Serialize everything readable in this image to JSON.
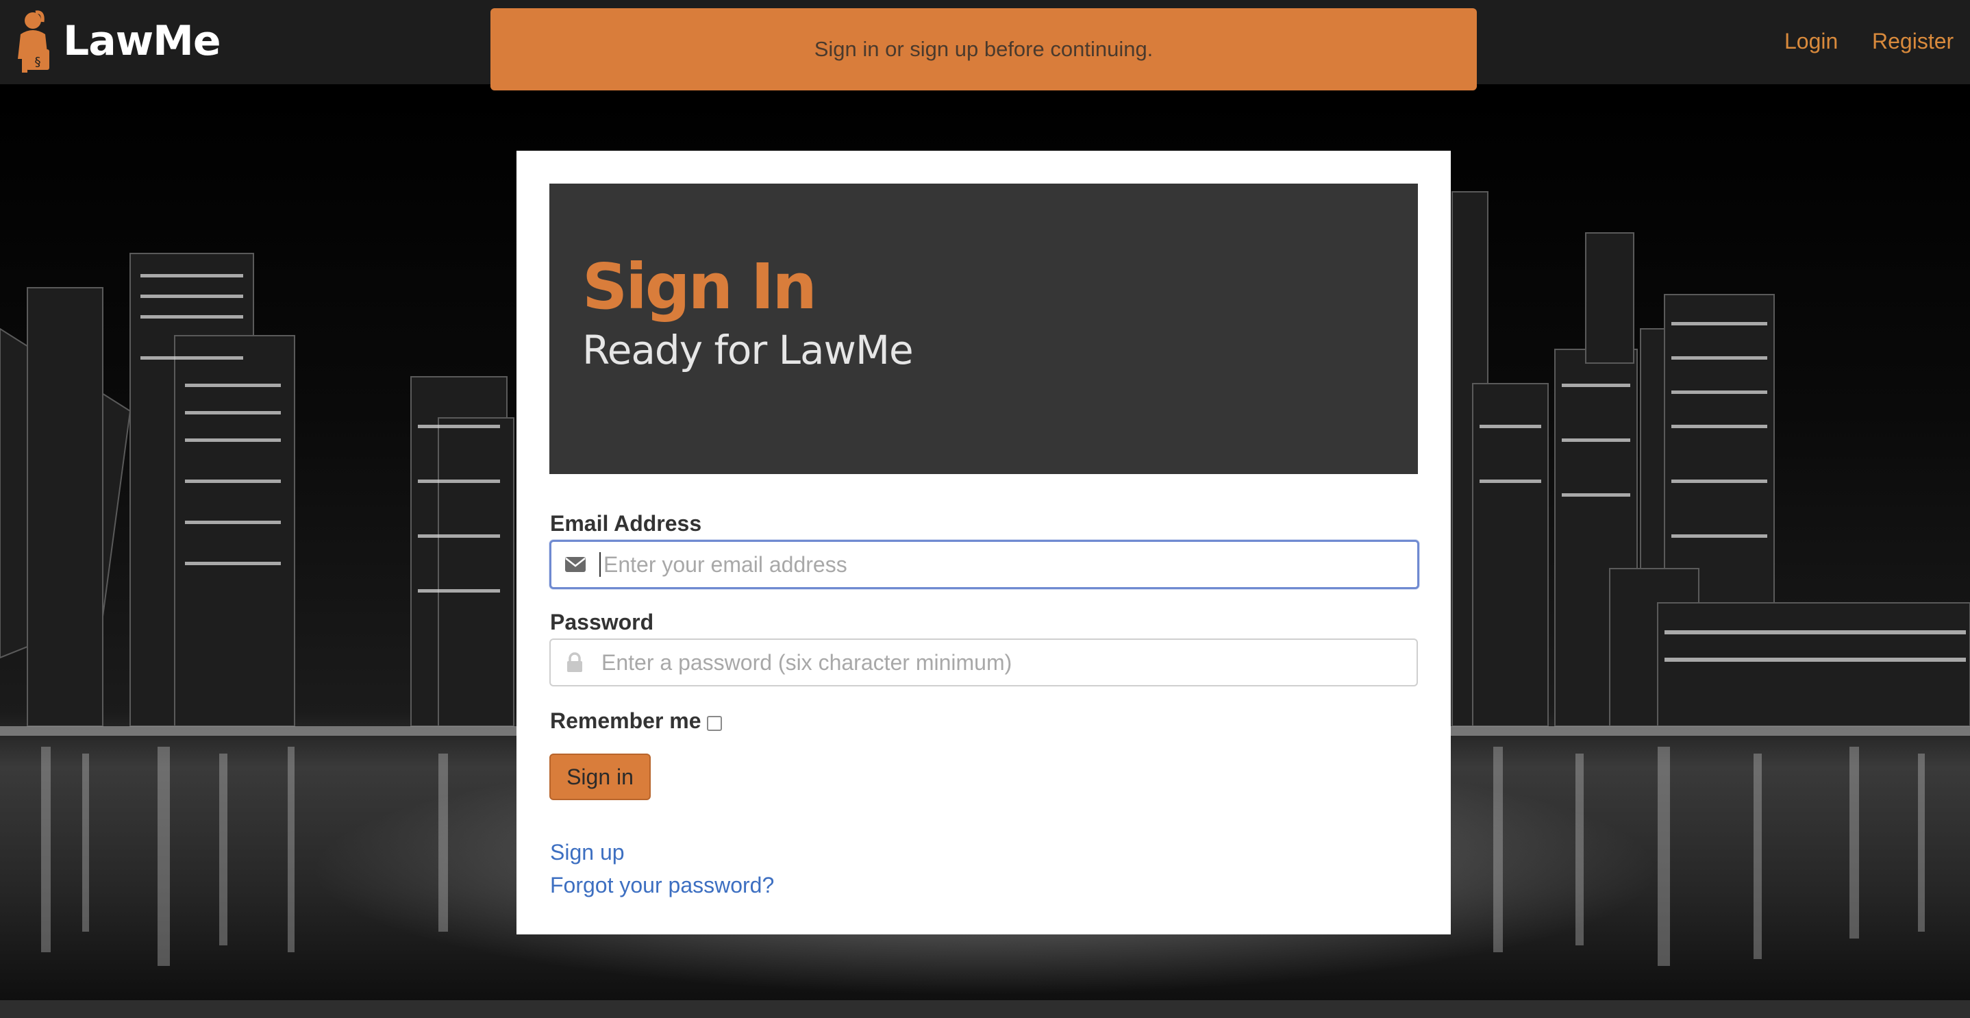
{
  "navbar": {
    "brand_name": "LawMe",
    "login_label": "Login",
    "register_label": "Register"
  },
  "alert": {
    "message": "Sign in or sign up before continuing."
  },
  "jumbotron": {
    "title": "Sign In",
    "subtitle": "Ready for LawMe"
  },
  "form": {
    "email_label": "Email Address",
    "email_placeholder": "Enter your email address",
    "email_value": "",
    "password_label": "Password",
    "password_placeholder": "Enter a password (six character minimum)",
    "password_value": "",
    "remember_label": "Remember me",
    "remember_checked": false,
    "submit_label": "Sign in"
  },
  "links": {
    "sign_up": "Sign up",
    "forgot_password": "Forgot your password?"
  },
  "icons": {
    "logo": "lawyer-figure-icon",
    "email": "envelope-icon",
    "password": "lock-icon"
  },
  "colors": {
    "accent": "#d97d3b",
    "navbar": "#1d1d1d",
    "jumbotron": "#363636",
    "link": "#3d6fc1",
    "focus_border": "#6f8ad1"
  }
}
